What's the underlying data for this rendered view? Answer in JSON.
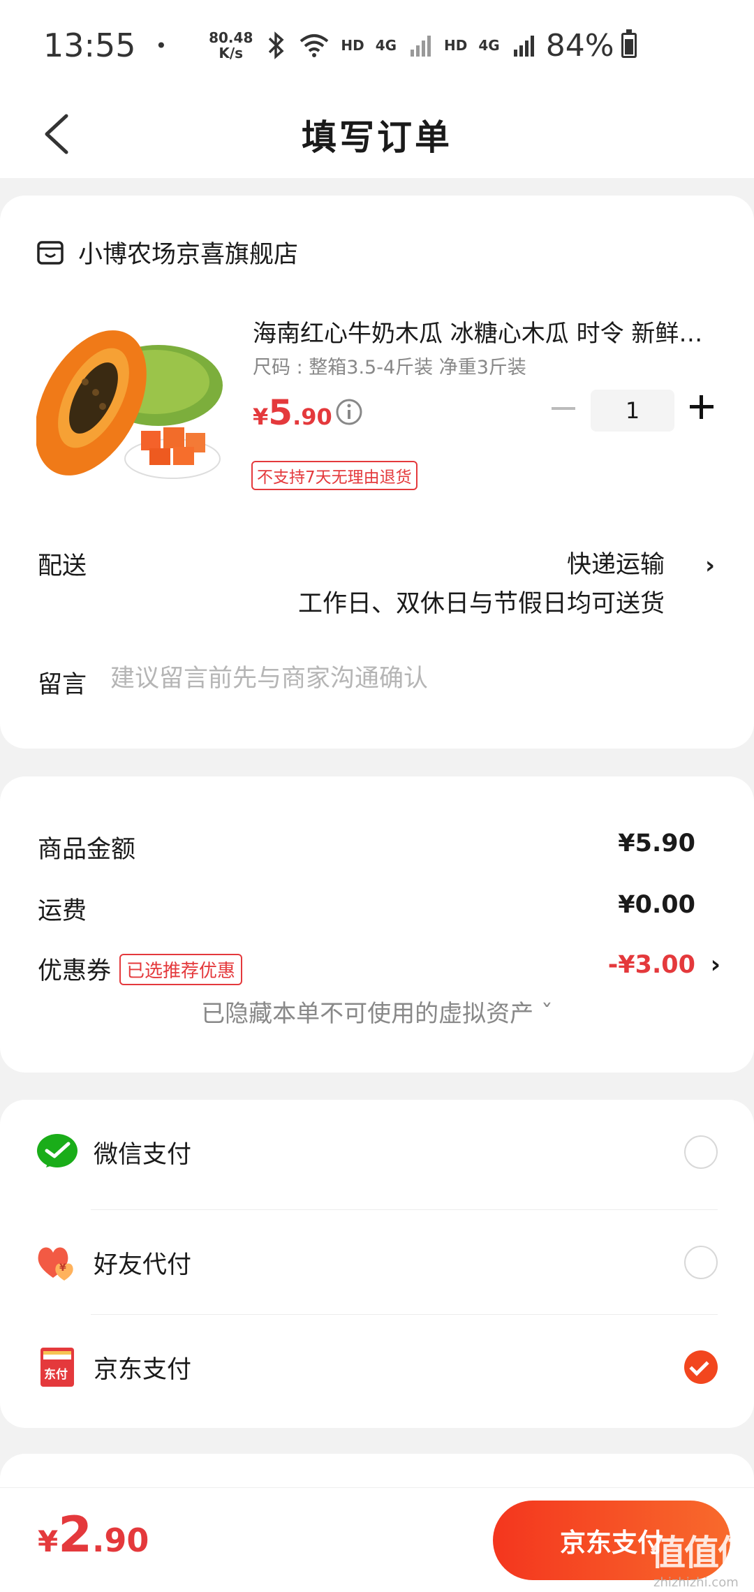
{
  "status_bar": {
    "time": "13:55",
    "dot": "•",
    "speed_value": "80.48",
    "speed_unit": "K/s",
    "hd1": "HD",
    "net1": "4G",
    "hd2": "HD",
    "net2": "4G",
    "battery": "84%"
  },
  "nav": {
    "title": "填写订单"
  },
  "store": {
    "name": "小博农场京喜旗舰店"
  },
  "product": {
    "title": "海南红心牛奶木瓜 冰糖心木瓜 时令 新鲜水果",
    "spec": "尺码 : 整箱3.5-4斤装  净重3斤装",
    "price_symbol": "¥",
    "price_int": "5",
    "price_dec": ".90",
    "quantity": "1",
    "return_tag": "不支持7天无理由退货"
  },
  "shipping": {
    "label": "配送",
    "method": "快递运输",
    "note": "工作日、双休日与节假日均可送货",
    "chevron": "›"
  },
  "message": {
    "label": "留言",
    "placeholder": "建议留言前先与商家沟通确认"
  },
  "amounts": {
    "goods_label": "商品金额",
    "goods_value": "¥5.90",
    "shipping_label": "运费",
    "shipping_value": "¥0.00",
    "coupon_label": "优惠券",
    "coupon_tag": "已选推荐优惠",
    "coupon_value": "-¥3.00",
    "chevron": "›",
    "hidden_assets": "已隐藏本单不可使用的虚拟资产 ˇ"
  },
  "payment_methods": [
    {
      "label": "微信支付",
      "icon": "wechat-pay-icon",
      "selected": false
    },
    {
      "label": "好友代付",
      "icon": "friend-pay-icon",
      "selected": false
    },
    {
      "label": "京东支付",
      "icon": "jd-pay-icon",
      "selected": true
    }
  ],
  "jd_pay_icon_text": "东付",
  "friend_pay_icon_text": "¥",
  "footer": {
    "total_symbol": "¥",
    "total_int": "2",
    "total_dec": ".90",
    "pay_button": "京东支付"
  },
  "watermark": {
    "logo": "值值值",
    "site": "zhizhizhi.com"
  },
  "colors": {
    "accent_red": "#e4393c",
    "pay_button": "#f4361e",
    "wechat_green": "#1aad19"
  }
}
